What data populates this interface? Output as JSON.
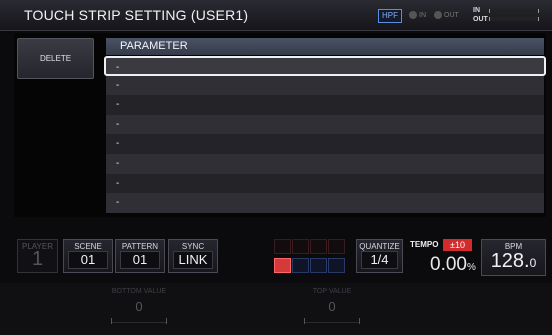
{
  "header": {
    "title": "TOUCH STRIP SETTING (USER1)",
    "hpf": "HPF",
    "in_label": "IN",
    "out_label": "OUT",
    "meter_in": "IN",
    "meter_out": "OUT"
  },
  "delete_label": "DELETE",
  "parameter_header": "PARAMETER",
  "parameters": [
    "-",
    "-",
    "-",
    "-",
    "-",
    "-",
    "-",
    "-"
  ],
  "player": {
    "label": "PLAYER",
    "value": "1"
  },
  "scene": {
    "label": "SCENE",
    "value": "01"
  },
  "pattern": {
    "label": "PATTERN",
    "value": "01"
  },
  "sync": {
    "label": "SYNC",
    "value": "LINK"
  },
  "quantize": {
    "label": "QUANTIZE",
    "value": "1/4"
  },
  "tempo": {
    "label": "TEMPO",
    "range": "±10",
    "value": "0.00",
    "unit": "%"
  },
  "bpm": {
    "label": "BPM",
    "value_int": "128.",
    "value_dec": "0"
  },
  "bottom_value": {
    "label": "BOTTOM VALUE",
    "value": "0"
  },
  "top_value": {
    "label": "TOP VALUE",
    "value": "0"
  },
  "colors": {
    "accent_red": "#d22b2b",
    "hpf_blue": "#5b8de0"
  }
}
